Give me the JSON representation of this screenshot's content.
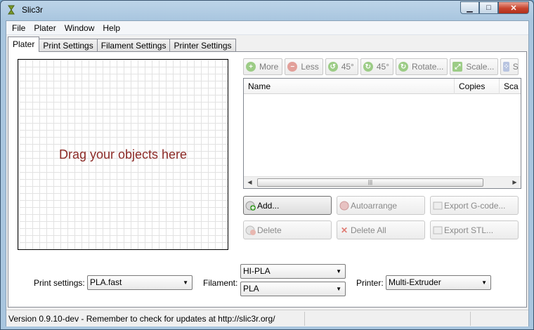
{
  "window": {
    "title": "Slic3r"
  },
  "menu": [
    "File",
    "Plater",
    "Window",
    "Help"
  ],
  "tabs": [
    "Plater",
    "Print Settings",
    "Filament Settings",
    "Printer Settings"
  ],
  "canvas": {
    "hint": "Drag your objects here"
  },
  "toolbar": [
    {
      "label": "More",
      "icon": "plus-icon"
    },
    {
      "label": "Less",
      "icon": "minus-icon"
    },
    {
      "label": "45°",
      "icon": "rotate-ccw-icon"
    },
    {
      "label": "45°",
      "icon": "rotate-cw-icon"
    },
    {
      "label": "Rotate...",
      "icon": "rotate-icon"
    },
    {
      "label": "Scale...",
      "icon": "scale-icon"
    },
    {
      "label": "Spli",
      "icon": "split-icon"
    }
  ],
  "object_list": {
    "columns": [
      "Name",
      "Copies",
      "Sca"
    ]
  },
  "actions": {
    "add": "Add...",
    "autoarrange": "Autoarrange",
    "export_gcode": "Export G-code...",
    "delete": "Delete",
    "delete_all": "Delete All",
    "export_stl": "Export STL..."
  },
  "settings": {
    "print_label": "Print settings:",
    "print_value": "PLA.fast",
    "filament_label": "Filament:",
    "filament_values": [
      "HI-PLA",
      "PLA"
    ],
    "printer_label": "Printer:",
    "printer_value": "Multi-Extruder"
  },
  "status": {
    "text": "Version 0.9.10-dev - Remember to check for updates at http://slic3r.org/"
  },
  "colors": {
    "hint": "#8b2a26",
    "close_button": "#c8452f"
  }
}
